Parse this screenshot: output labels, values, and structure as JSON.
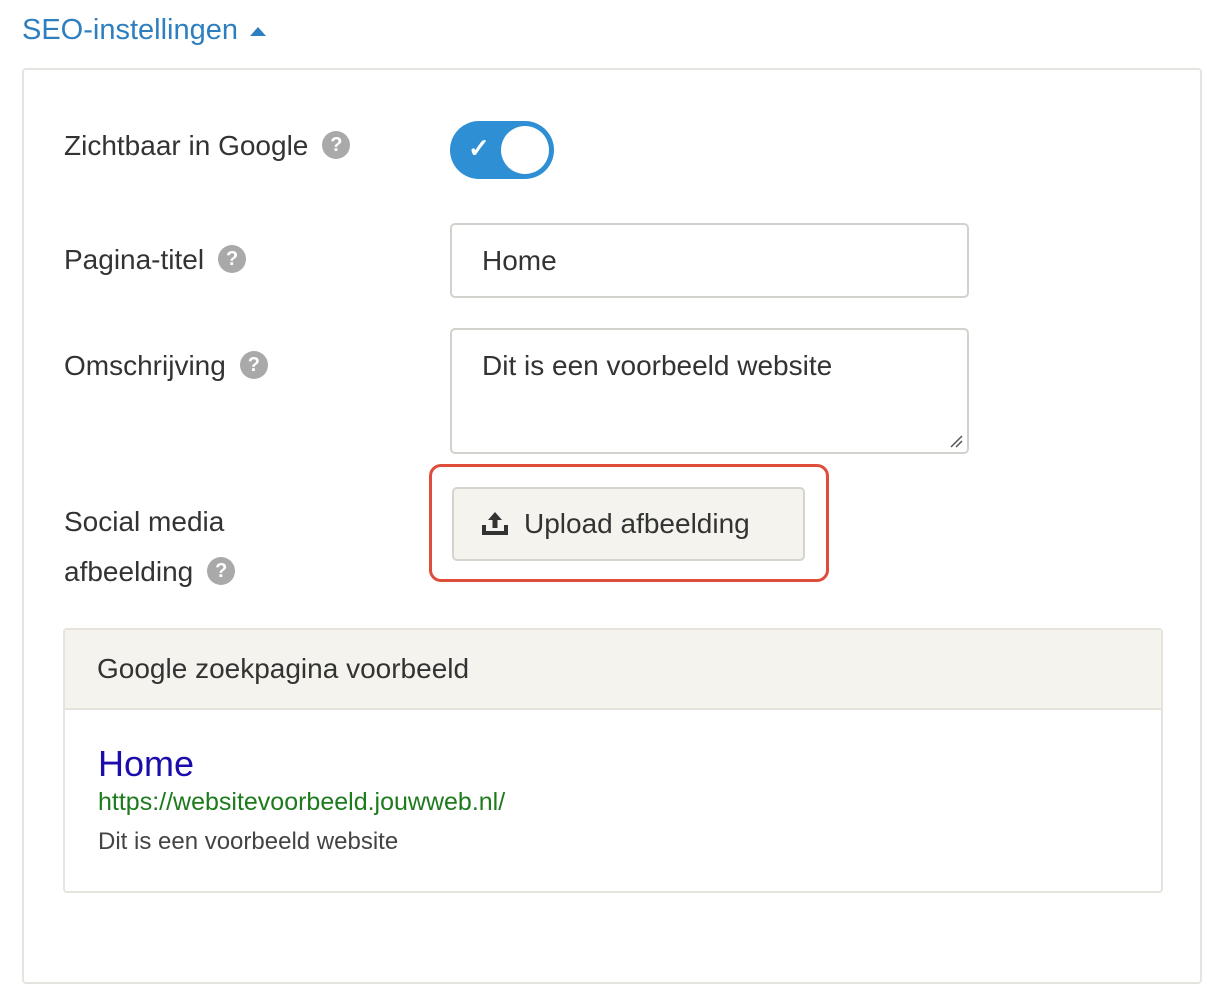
{
  "header": {
    "section_title": "SEO-instellingen"
  },
  "visible_in_google": {
    "label": "Zichtbaar in Google",
    "enabled": true,
    "check_glyph": "✓"
  },
  "page_title": {
    "label": "Pagina-titel",
    "value": "Home"
  },
  "description": {
    "label": "Omschrijving",
    "value": "Dit is een voorbeeld website"
  },
  "social_image": {
    "label_line1": "Social media",
    "label_line2": "afbeelding",
    "button_label": "Upload afbeelding",
    "icon": "upload-icon"
  },
  "help_glyph": "?",
  "google_preview": {
    "header": "Google zoekpagina voorbeeld",
    "title": "Home",
    "url": "https://websitevoorbeeld.jouwweb.nl/",
    "description": "Dit is een voorbeeld website"
  },
  "colors": {
    "accent": "#2e8fd4",
    "link_blue": "#1a0dab",
    "url_green": "#1d7b1d",
    "highlight_red": "#de4c3a"
  }
}
